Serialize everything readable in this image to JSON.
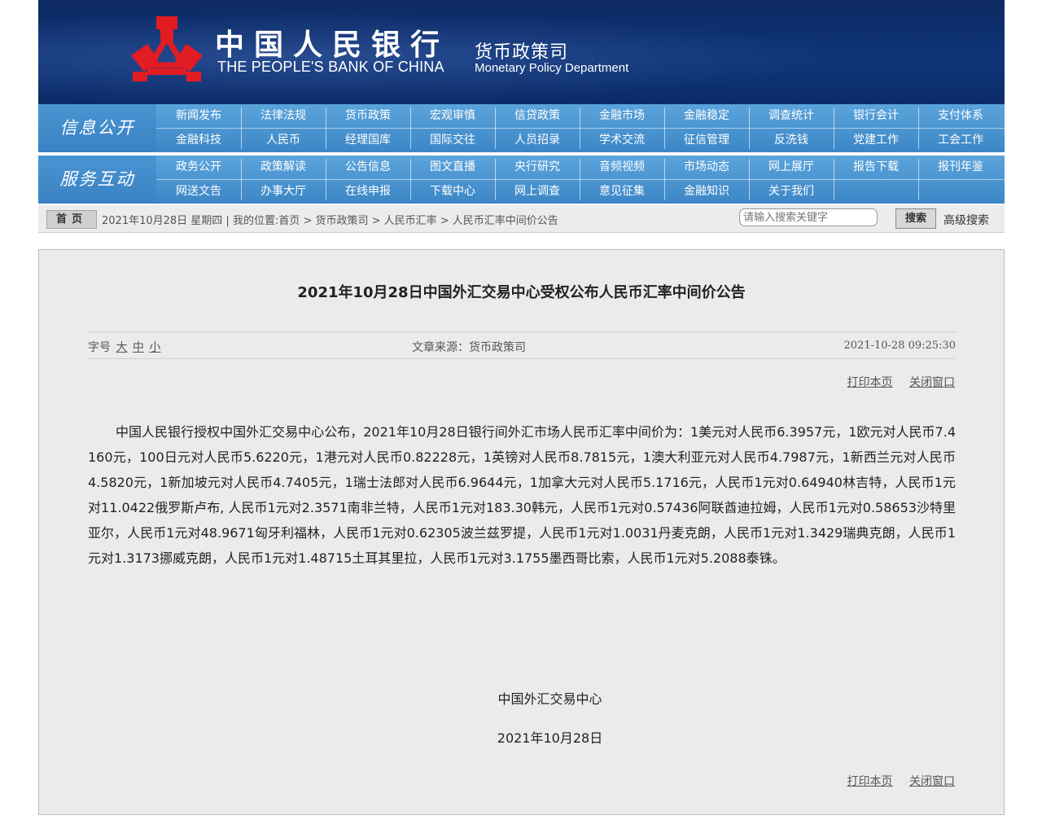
{
  "header": {
    "bank_name_cn": "中国人民银行",
    "bank_name_en": "THE PEOPLE'S BANK OF CHINA",
    "dept_cn": "货币政策司",
    "dept_en": "Monetary Policy Department"
  },
  "nav": {
    "group1_title": "信息公开",
    "group1_items": [
      "新闻发布",
      "法律法规",
      "货币政策",
      "宏观审慎",
      "信贷政策",
      "金融市场",
      "金融稳定",
      "调查统计",
      "银行会计",
      "支付体系",
      "金融科技",
      "人民币",
      "经理国库",
      "国际交往",
      "人员招录",
      "学术交流",
      "征信管理",
      "反洗钱",
      "党建工作",
      "工会工作"
    ],
    "group2_title": "服务互动",
    "group2_items": [
      "政务公开",
      "政策解读",
      "公告信息",
      "图文直播",
      "央行研究",
      "音频视频",
      "市场动态",
      "网上展厅",
      "报告下载",
      "报刊年鉴",
      "网送文告",
      "办事大厅",
      "在线申报",
      "下载中心",
      "网上调查",
      "意见征集",
      "金融知识",
      "关于我们"
    ]
  },
  "breadcrumb": {
    "home_label": "首页",
    "text": "2021年10月28日 星期四 | 我的位置:首页 > 货币政策司 > 人民币汇率 > 人民币汇率中间价公告",
    "search_placeholder": "请输入搜索关键字",
    "search_button": "搜索",
    "advanced_search": "高级搜索"
  },
  "article": {
    "title": "2021年10月28日中国外汇交易中心受权公布人民币汇率中间价公告",
    "font_size_label": "字号",
    "font_sizes": [
      "大",
      "中",
      "小"
    ],
    "source": "文章来源：货币政策司",
    "datetime": "2021-10-28 09:25:30",
    "print_label": "打印本页",
    "close_label": "关闭窗口",
    "body": "中国人民银行授权中国外汇交易中心公布，2021年10月28日银行间外汇市场人民币汇率中间价为：1美元对人民币6.3957元，1欧元对人民币7.4160元，100日元对人民币5.6220元，1港元对人民币0.82228元，1英镑对人民币8.7815元，1澳大利亚元对人民币4.7987元，1新西兰元对人民币4.5820元，1新加坡元对人民币4.7405元，1瑞士法郎对人民币6.9644元，1加拿大元对人民币5.1716元，人民币1元对0.64940林吉特，人民币1元对11.0422俄罗斯卢布, 人民币1元对2.3571南非兰特，人民币1元对183.30韩元，人民币1元对0.57436阿联酋迪拉姆，人民币1元对0.58653沙特里亚尔，人民币1元对48.9671匈牙利福林，人民币1元对0.62305波兰兹罗提，人民币1元对1.0031丹麦克朗，人民币1元对1.3429瑞典克朗，人民币1元对1.3173挪威克朗，人民币1元对1.48715土耳其里拉，人民币1元对3.1755墨西哥比索，人民币1元对5.2088泰铢。",
    "signature_org": "中国外汇交易中心",
    "signature_date": "2021年10月28日"
  },
  "colors": {
    "banner": "#0e3478",
    "nav": "#4a94d2",
    "logo_red": "#e31b23",
    "content_bg": "#ebebeb"
  }
}
